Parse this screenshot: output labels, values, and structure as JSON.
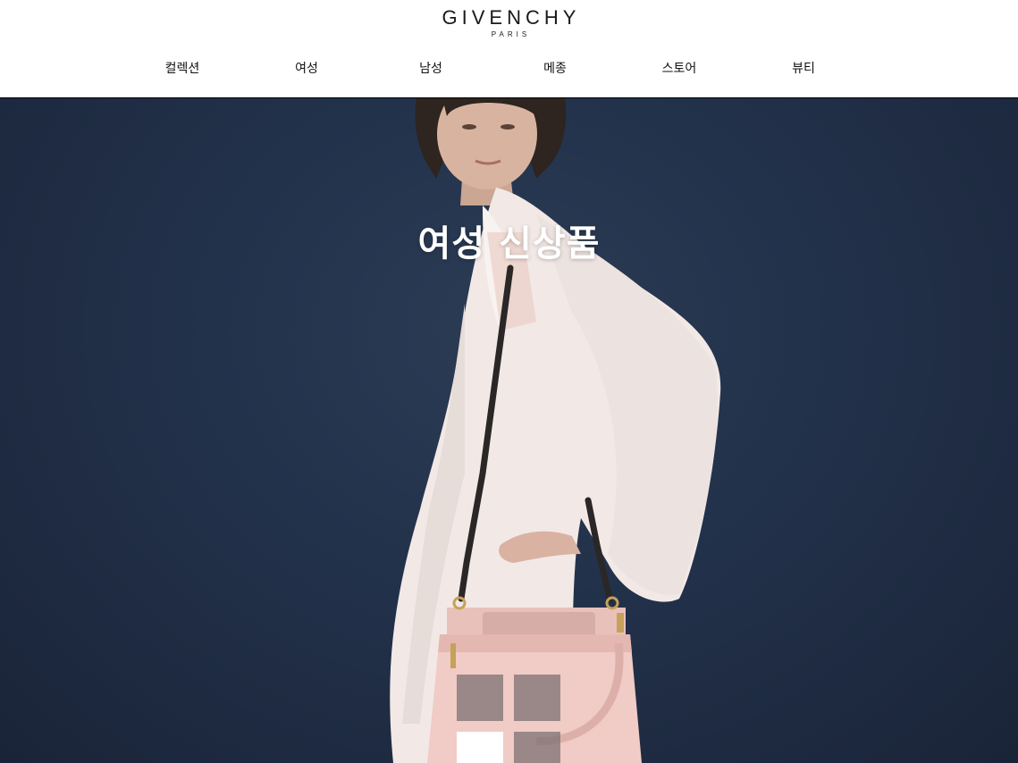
{
  "brand": {
    "name": "GIVENCHY",
    "subtitle": "PARIS"
  },
  "nav": {
    "items": [
      {
        "label": "컬렉션"
      },
      {
        "label": "여성"
      },
      {
        "label": "남성"
      },
      {
        "label": "메종"
      },
      {
        "label": "스토어"
      },
      {
        "label": "뷰티"
      }
    ]
  },
  "hero": {
    "title": "여성 신상품",
    "background_color": "#22314a"
  },
  "carousel": {
    "slide_count": 4,
    "active_index": 2
  }
}
